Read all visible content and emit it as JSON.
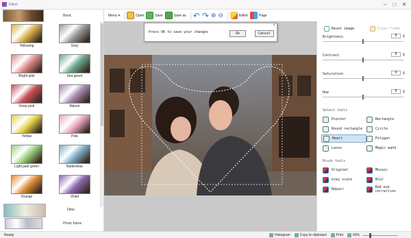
{
  "window": {
    "title": "Effect"
  },
  "left_panel": {
    "category": "Basic",
    "effects": [
      {
        "label": "Yellowing",
        "tint": "#d8b04a"
      },
      {
        "label": "Grey",
        "tint": "#9a9a9a"
      },
      {
        "label": "Bright pink",
        "tint": "#e08a8a"
      },
      {
        "label": "Sea green",
        "tint": "#6aa98f"
      },
      {
        "label": "Deep pink",
        "tint": "#c8505a"
      },
      {
        "label": "Mauve",
        "tint": "#a98ab0"
      },
      {
        "label": "Yellow",
        "tint": "#e2d24a"
      },
      {
        "label": "Pink",
        "tint": "#e8a8c0"
      },
      {
        "label": "Light jade green",
        "tint": "#9ad07a"
      },
      {
        "label": "Nattierblue",
        "tint": "#7fb0c8"
      },
      {
        "label": "Orange",
        "tint": "#e0903a"
      },
      {
        "label": "Violet",
        "tint": "#8a6ab0"
      }
    ],
    "filter_label": "Filter",
    "frame_label": "Photo frame"
  },
  "toolbar": {
    "menu": "Menu",
    "open": "Open",
    "save": "Save",
    "save_as": "Save as",
    "editor": "Editor",
    "page": "Page"
  },
  "dialog": {
    "message": "Press OK to save your changes",
    "ok": "Ok",
    "cancel": "Cancel"
  },
  "right_panel": {
    "reset_image": "Reset image",
    "clear_frame": "Clear frame",
    "adjustments": [
      {
        "label": "Brightness",
        "value": "0",
        "level": 0.5
      },
      {
        "label": "Contrast",
        "value": "0",
        "level": 0.5
      },
      {
        "label": "Saturation",
        "value": "0",
        "level": 0.5
      },
      {
        "label": "Hue",
        "value": "0",
        "level": 0.5
      }
    ],
    "select_tools_title": "Select tools",
    "select_tools": [
      {
        "label": "Pointer",
        "icon": "pointer-icon"
      },
      {
        "label": "Rectangle",
        "icon": "rectangle-icon"
      },
      {
        "label": "Round rectangle",
        "icon": "round-rectangle-icon"
      },
      {
        "label": "Circle",
        "icon": "circle-icon"
      },
      {
        "label": "Heart",
        "icon": "heart-icon",
        "active": true
      },
      {
        "label": "Polygon",
        "icon": "polygon-icon"
      },
      {
        "label": "Lasso",
        "icon": "lasso-icon"
      },
      {
        "label": "Magic wand",
        "icon": "magic-wand-icon"
      }
    ],
    "brush_tools_title": "Brush tools",
    "brush_tools": [
      {
        "label": "Original",
        "icon": "original-brush-icon"
      },
      {
        "label": "Mosaic",
        "icon": "mosaic-brush-icon"
      },
      {
        "label": "Grey scale",
        "icon": "grey-scale-brush-icon"
      },
      {
        "label": "Blur",
        "icon": "blur-brush-icon"
      },
      {
        "label": "Repair",
        "icon": "repair-brush-icon"
      },
      {
        "label": "Red eye correction",
        "icon": "red-eye-icon"
      }
    ]
  },
  "status": {
    "ready": "Ready",
    "histogram": "Histogram",
    "copy": "Copy to clipboard",
    "print": "Print",
    "zoom": "60%"
  }
}
